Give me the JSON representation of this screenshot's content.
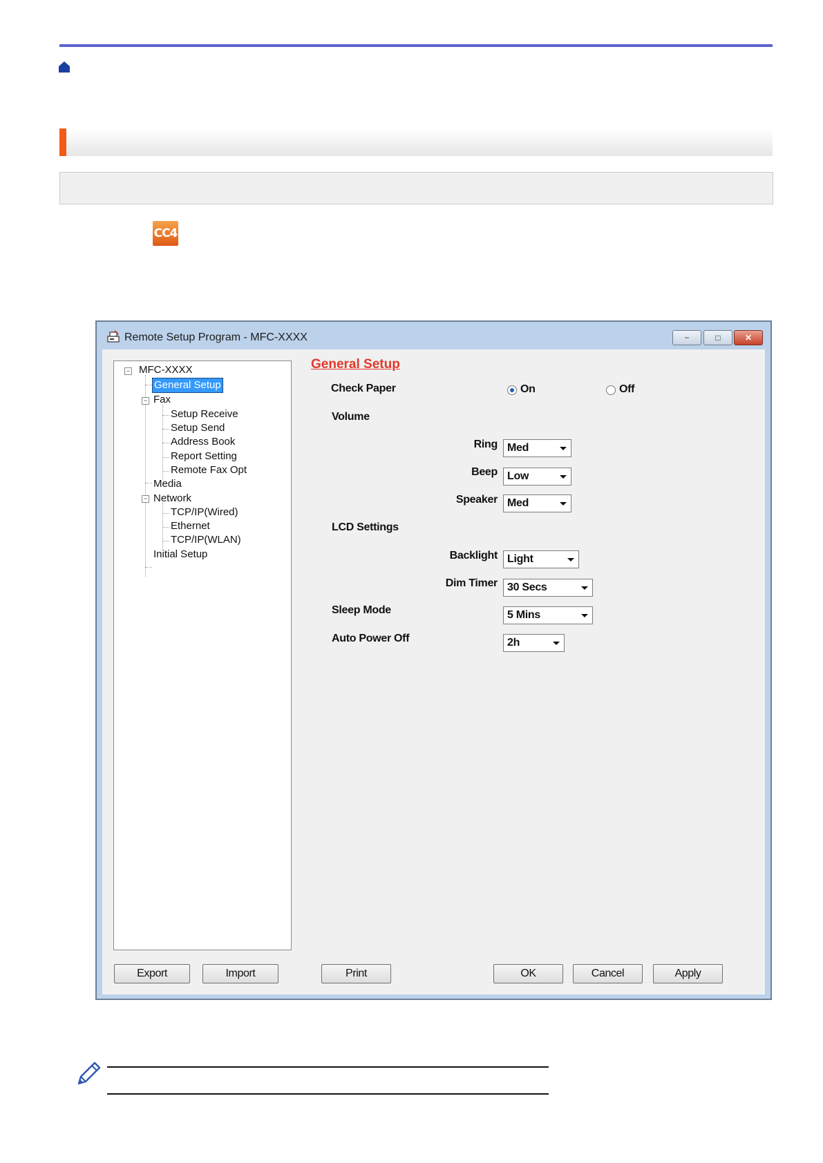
{
  "header": {
    "home_icon": "home-icon"
  },
  "app_icon": {
    "label": "CC4"
  },
  "window": {
    "title": "Remote Setup Program - MFC-XXXX",
    "controls": {
      "minimize": "−",
      "maximize": "□",
      "close": "✕"
    }
  },
  "tree": {
    "root": "MFC-XXXX",
    "general_setup": "General Setup",
    "fax": "Fax",
    "setup_receive": "Setup Receive",
    "setup_send": "Setup Send",
    "address_book": "Address Book",
    "report_setting": "Report Setting",
    "remote_fax_opt": "Remote Fax Opt",
    "media": "Media",
    "network": "Network",
    "tcpip_wired": "TCP/IP(Wired)",
    "ethernet": "Ethernet",
    "tcpip_wlan": "TCP/IP(WLAN)",
    "initial_setup": "Initial Setup"
  },
  "form": {
    "title": "General Setup",
    "check_paper": {
      "label": "Check Paper",
      "on": "On",
      "off": "Off",
      "selected": "On"
    },
    "volume": {
      "label": "Volume",
      "ring": {
        "label": "Ring",
        "value": "Med"
      },
      "beep": {
        "label": "Beep",
        "value": "Low"
      },
      "speaker": {
        "label": "Speaker",
        "value": "Med"
      }
    },
    "lcd": {
      "label": "LCD Settings",
      "backlight": {
        "label": "Backlight",
        "value": "Light"
      },
      "dim_timer": {
        "label": "Dim Timer",
        "value": "30 Secs"
      }
    },
    "sleep_mode": {
      "label": "Sleep Mode",
      "value": "5 Mins"
    },
    "auto_power_off": {
      "label": "Auto Power Off",
      "value": "2h"
    }
  },
  "buttons": {
    "export": "Export",
    "import": "Import",
    "print": "Print",
    "ok": "OK",
    "cancel": "Cancel",
    "apply": "Apply"
  }
}
